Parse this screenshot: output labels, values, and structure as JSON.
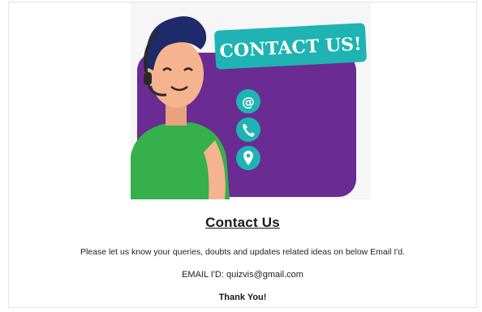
{
  "hero": {
    "banner_text": "CONTACT US!",
    "icons": [
      "at-icon",
      "phone-icon",
      "location-pin-icon"
    ],
    "colors": {
      "purple": "#6a2b93",
      "teal": "#1fb3b3",
      "shirt": "#35b04a",
      "hair": "#1f2a6b",
      "skin": "#f5b48f"
    }
  },
  "content": {
    "title": "Contact Us",
    "description": "Please let us know your queries, doubts and updates related ideas on below Email I'd.",
    "email_label": "EMAIL I'D:",
    "email_value": "quizvis@gmail.com",
    "thanks": "Thank You!"
  }
}
